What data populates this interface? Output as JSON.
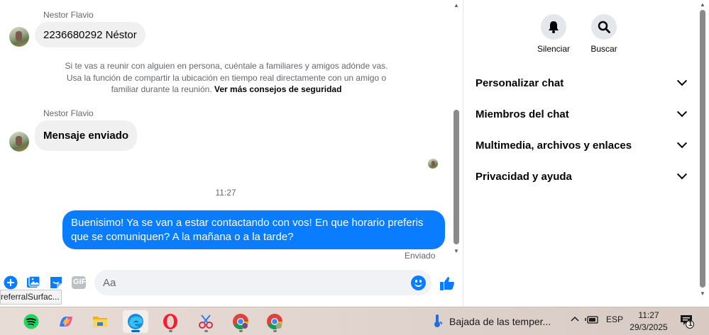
{
  "chat": {
    "messages": [
      {
        "sender": "Nestor Flavio",
        "text": "2236680292 Néstor"
      },
      {
        "sender": "Nestor Flavio",
        "text": "Mensaje enviado"
      }
    ],
    "safety_notice": {
      "text": "Si te vas a reunir con alguien en persona, cuéntale a familiares y amigos adónde vas. Usa la función de compartir la ubicación en tiempo real directamente con un amigo o familiar durante la reunión.",
      "link": "Ver más consejos de seguridad"
    },
    "time_separator": "11:27",
    "outgoing_message": "Buenisimo! Ya se van a estar contactando con vos! En que horario preferis que se comuniquen? A la mañana o a la tarde?",
    "outgoing_status": "Enviado",
    "composer": {
      "placeholder": "Aa",
      "gif_label": "GIF"
    },
    "tooltip": "referralSurfac..."
  },
  "info_panel": {
    "actions": [
      {
        "label": "Silenciar",
        "icon": "bell-icon"
      },
      {
        "label": "Buscar",
        "icon": "search-icon"
      }
    ],
    "sections": [
      {
        "label": "Personalizar chat"
      },
      {
        "label": "Miembros del chat"
      },
      {
        "label": "Multimedia, archivos y enlaces"
      },
      {
        "label": "Privacidad y ayuda"
      }
    ]
  },
  "taskbar": {
    "apps": [
      "spotify-icon",
      "copilot-icon",
      "file-explorer-icon",
      "edge-icon",
      "opera-icon",
      "snipping-tool-icon",
      "chrome-icon",
      "chrome-profile-icon"
    ],
    "weather_text": "Bajada de las temper...",
    "language": "ESP",
    "time": "11:27",
    "date": "29/3/2025",
    "notification_count": "1"
  },
  "colors": {
    "messenger_blue": "#0a7cff",
    "bubble_gray": "#f0f0f0",
    "text_secondary": "#65676b"
  }
}
